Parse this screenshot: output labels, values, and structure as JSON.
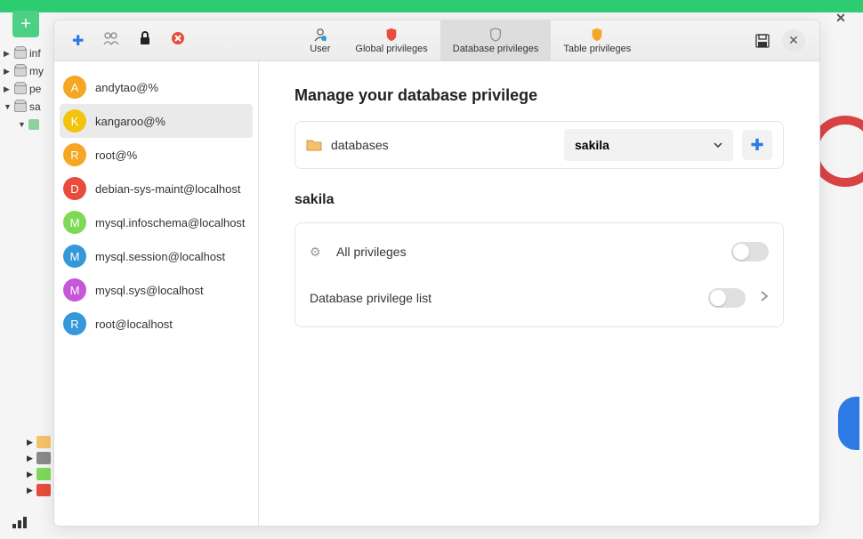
{
  "titlebar": {
    "close": "✕"
  },
  "tree": {
    "items": [
      {
        "label": "inf"
      },
      {
        "label": "my"
      },
      {
        "label": "pe"
      },
      {
        "label": "sa",
        "expanded": true
      }
    ]
  },
  "modal": {
    "tabs": {
      "user": "User",
      "global": "Global privileges",
      "database": "Database privileges",
      "table": "Table privileges"
    },
    "users": [
      {
        "initial": "A",
        "label": "andytao@%",
        "color": "#f5a623"
      },
      {
        "initial": "K",
        "label": "kangaroo@%",
        "color": "#f1c40f",
        "selected": true
      },
      {
        "initial": "R",
        "label": "root@%",
        "color": "#f5a623"
      },
      {
        "initial": "D",
        "label": "debian-sys-maint@localhost",
        "color": "#e74c3c"
      },
      {
        "initial": "M",
        "label": "mysql.infoschema@localhost",
        "color": "#7ed957"
      },
      {
        "initial": "M",
        "label": "mysql.session@localhost",
        "color": "#3498db"
      },
      {
        "initial": "M",
        "label": "mysql.sys@localhost",
        "color": "#c657d9"
      },
      {
        "initial": "R",
        "label": "root@localhost",
        "color": "#3498db"
      }
    ],
    "main": {
      "title": "Manage your database privilege",
      "db_label": "databases",
      "db_selected": "sakila",
      "section": "sakila",
      "all_priv": "All privileges",
      "list_label": "Database privilege list"
    }
  }
}
